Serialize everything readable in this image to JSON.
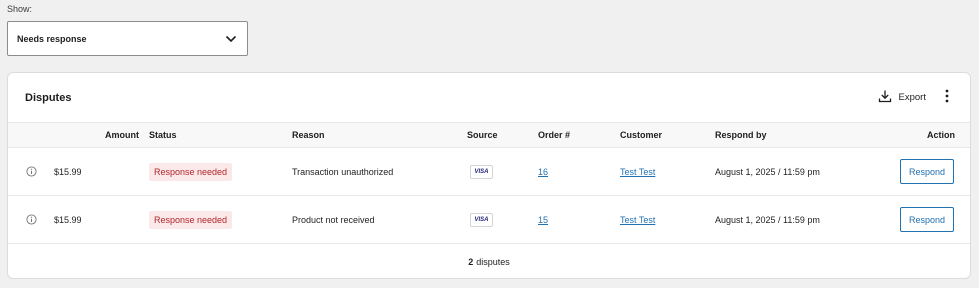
{
  "filter": {
    "label": "Show:",
    "selected": "Needs response"
  },
  "card": {
    "title": "Disputes",
    "export_label": "Export"
  },
  "table": {
    "headers": {
      "amount": "Amount",
      "status": "Status",
      "reason": "Reason",
      "source": "Source",
      "order": "Order #",
      "customer": "Customer",
      "respond_by": "Respond by",
      "action": "Action"
    },
    "rows": [
      {
        "amount": "$15.99",
        "status": "Response needed",
        "reason": "Transaction unauthorized",
        "source": "VISA",
        "order": "16",
        "customer": "Test Test",
        "respond_by": "August 1, 2025 / 11:59 pm",
        "action": "Respond"
      },
      {
        "amount": "$15.99",
        "status": "Response needed",
        "reason": "Product not received",
        "source": "VISA",
        "order": "15",
        "customer": "Test Test",
        "respond_by": "August 1, 2025 / 11:59 pm",
        "action": "Respond"
      }
    ]
  },
  "footer": {
    "count": "2",
    "count_label": "disputes"
  },
  "icons": {
    "select": "chevron-down-icon",
    "export": "download-icon",
    "more": "more-vertical-icon",
    "row": "info-icon"
  },
  "colors": {
    "badge_bg": "#fbe9ea",
    "badge_text": "#b3262d",
    "link": "#2271b1"
  }
}
